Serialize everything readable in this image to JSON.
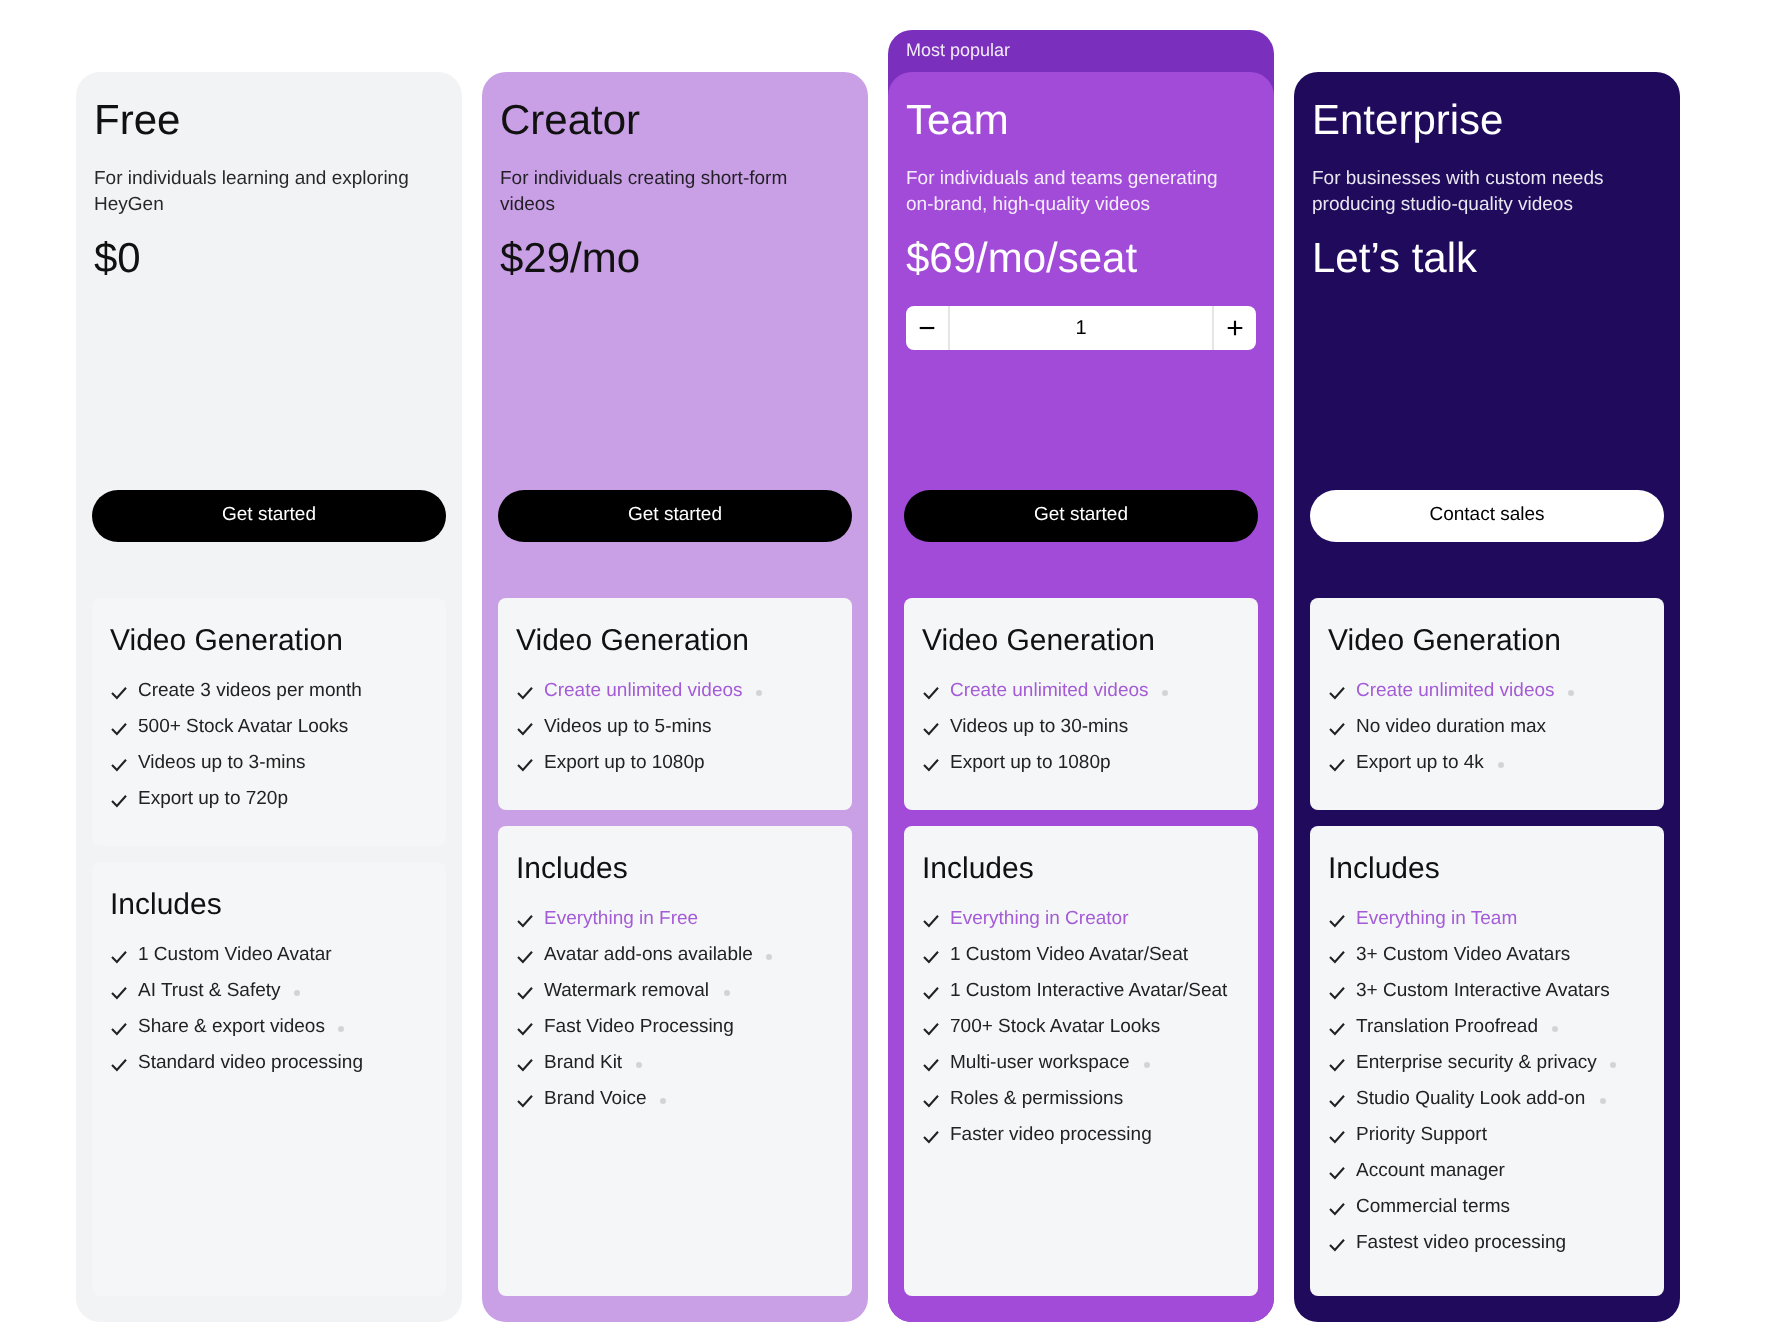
{
  "plans": [
    {
      "name": "Free",
      "description": "For individuals learning and exploring HeyGen",
      "price": "$0",
      "button": {
        "label": "Get started"
      },
      "sections": [
        {
          "title": "Video Generation",
          "items": [
            {
              "text": "Create 3 videos per month",
              "highlighted": false,
              "info_dot": false
            },
            {
              "text": "500+ Stock Avatar Looks",
              "highlighted": false,
              "info_dot": false
            },
            {
              "text": "Videos up to 3-mins",
              "highlighted": false,
              "info_dot": false
            },
            {
              "text": "Export up to 720p",
              "highlighted": false,
              "info_dot": false
            }
          ]
        },
        {
          "title": "Includes",
          "items": [
            {
              "text": "1 Custom Video Avatar",
              "highlighted": false,
              "info_dot": false
            },
            {
              "text": "AI Trust & Safety",
              "highlighted": false,
              "info_dot": true
            },
            {
              "text": "Share & export videos",
              "highlighted": false,
              "info_dot": true
            },
            {
              "text": "Standard video processing",
              "highlighted": false,
              "info_dot": false
            }
          ]
        }
      ]
    },
    {
      "name": "Creator",
      "description": "For individuals creating short-form videos",
      "price": "$29/mo",
      "button": {
        "label": "Get started"
      },
      "sections": [
        {
          "title": "Video Generation",
          "items": [
            {
              "text": "Create unlimited videos",
              "highlighted": true,
              "info_dot": true
            },
            {
              "text": "Videos up to 5-mins",
              "highlighted": false,
              "info_dot": false
            },
            {
              "text": "Export up to 1080p",
              "highlighted": false,
              "info_dot": false
            }
          ]
        },
        {
          "title": "Includes",
          "items": [
            {
              "text": "Everything in Free",
              "highlighted": true,
              "info_dot": false
            },
            {
              "text": "Avatar add-ons available",
              "highlighted": false,
              "info_dot": true
            },
            {
              "text": "Watermark removal",
              "highlighted": false,
              "info_dot": true
            },
            {
              "text": "Fast Video Processing",
              "highlighted": false,
              "info_dot": false
            },
            {
              "text": "Brand Kit",
              "highlighted": false,
              "info_dot": true
            },
            {
              "text": "Brand Voice",
              "highlighted": false,
              "info_dot": true
            }
          ]
        }
      ]
    },
    {
      "name": "Team",
      "badge": "Most popular",
      "description": "For individuals and teams generating on-brand, high-quality videos",
      "price": "$69/mo/seat",
      "seats": {
        "minus": "−",
        "value": "1",
        "plus": "+"
      },
      "button": {
        "label": "Get started"
      },
      "sections": [
        {
          "title": "Video Generation",
          "items": [
            {
              "text": "Create unlimited videos",
              "highlighted": true,
              "info_dot": true
            },
            {
              "text": "Videos up to 30-mins",
              "highlighted": false,
              "info_dot": false
            },
            {
              "text": "Export up to 1080p",
              "highlighted": false,
              "info_dot": false
            }
          ]
        },
        {
          "title": "Includes",
          "items": [
            {
              "text": "Everything in Creator",
              "highlighted": true,
              "info_dot": false
            },
            {
              "text": "1 Custom Video Avatar/Seat",
              "highlighted": false,
              "info_dot": false
            },
            {
              "text": "1 Custom Interactive Avatar/Seat",
              "highlighted": false,
              "info_dot": false
            },
            {
              "text": "700+ Stock Avatar Looks",
              "highlighted": false,
              "info_dot": false
            },
            {
              "text": "Multi-user workspace",
              "highlighted": false,
              "info_dot": true
            },
            {
              "text": "Roles & permissions",
              "highlighted": false,
              "info_dot": false
            },
            {
              "text": "Faster video processing",
              "highlighted": false,
              "info_dot": false
            }
          ]
        }
      ]
    },
    {
      "name": "Enterprise",
      "description": "For businesses with custom needs producing studio-quality videos",
      "price": "Let’s talk",
      "button": {
        "label": "Contact sales"
      },
      "sections": [
        {
          "title": "Video Generation",
          "items": [
            {
              "text": "Create unlimited videos",
              "highlighted": true,
              "info_dot": true
            },
            {
              "text": "No video duration max",
              "highlighted": false,
              "info_dot": false
            },
            {
              "text": "Export up to 4k",
              "highlighted": false,
              "info_dot": true
            }
          ]
        },
        {
          "title": "Includes",
          "items": [
            {
              "text": "Everything in Team",
              "highlighted": true,
              "info_dot": false
            },
            {
              "text": "3+ Custom Video Avatars",
              "highlighted": false,
              "info_dot": false
            },
            {
              "text": "3+ Custom Interactive Avatars",
              "highlighted": false,
              "info_dot": false
            },
            {
              "text": "Translation Proofread",
              "highlighted": false,
              "info_dot": true
            },
            {
              "text": "Enterprise security & privacy",
              "highlighted": false,
              "info_dot": true
            },
            {
              "text": "Studio Quality Look add-on",
              "highlighted": false,
              "info_dot": true
            },
            {
              "text": "Priority Support",
              "highlighted": false,
              "info_dot": false
            },
            {
              "text": "Account manager",
              "highlighted": false,
              "info_dot": false
            },
            {
              "text": "Commercial terms",
              "highlighted": false,
              "info_dot": false
            },
            {
              "text": "Fastest video processing",
              "highlighted": false,
              "info_dot": false
            }
          ]
        }
      ]
    }
  ]
}
